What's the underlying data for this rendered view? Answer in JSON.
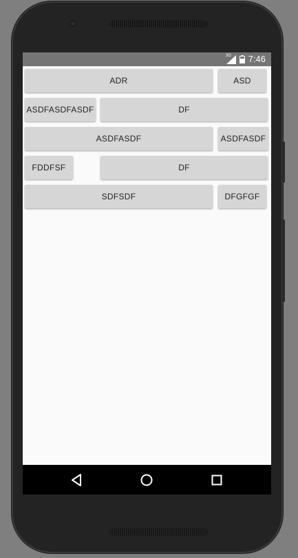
{
  "status_bar": {
    "network_label": "3G",
    "time": "7:46",
    "icons": [
      "signal-icon",
      "battery-icon"
    ]
  },
  "buttons": {
    "row1_main": "ADR",
    "row1_side": "ASD",
    "row2_left": "ASDFASDFASDF",
    "row2_right": "DF",
    "row3_main": "ASDFASDF",
    "row3_side": "ASDFASDF",
    "row4_left": "FDDFSF",
    "row4_right": "DF",
    "row5_main": "SDFSDF",
    "row5_side": "DFGFGF"
  },
  "nav_bar": {
    "icons": [
      "back-icon",
      "home-icon",
      "recents-icon"
    ]
  },
  "colors": {
    "status_bar": "#757575",
    "screen_bg": "#fafafa",
    "button_bg": "#d6d6d6",
    "nav_bar": "#000000",
    "device_body": "#232323",
    "backdrop": "#7f7f7f"
  }
}
